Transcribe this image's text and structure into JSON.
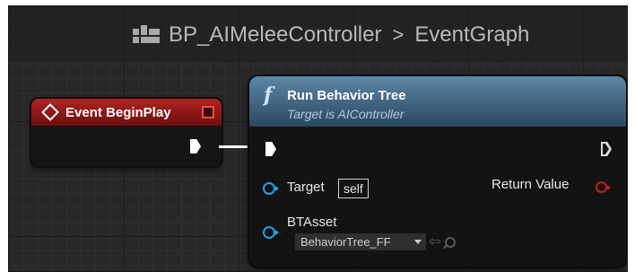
{
  "breadcrumb": {
    "blueprint_icon": "blueprint-grid-icon",
    "blueprint": "BP_AIMeleeController",
    "separator": ">",
    "graph": "EventGraph"
  },
  "event_node": {
    "icon": "diamond-event-icon",
    "title": "Event BeginPlay",
    "header_color": "#a01a1a"
  },
  "function_node": {
    "icon_glyph": "f",
    "title": "Run Behavior Tree",
    "subtitle": "Target is AIController",
    "header_color": "#4d7393",
    "target_label": "Target",
    "target_value": "self",
    "return_label": "Return Value",
    "bt_asset_label": "BTAsset",
    "bt_asset_value": "BehaviorTree_FF",
    "object_pin_color": "#1fa3e8",
    "return_pin_color": "#c01f1f"
  }
}
